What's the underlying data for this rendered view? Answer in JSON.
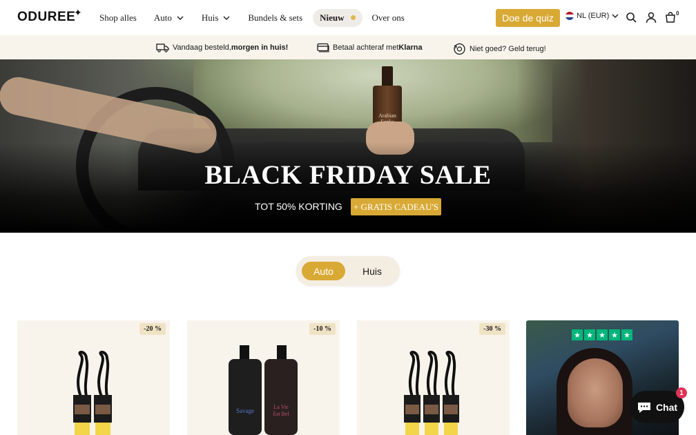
{
  "header": {
    "logo": "ODUREE",
    "nav": [
      {
        "label": "Shop alles",
        "has_dropdown": false
      },
      {
        "label": "Auto",
        "has_dropdown": true
      },
      {
        "label": "Huis",
        "has_dropdown": true
      },
      {
        "label": "Bundels & sets",
        "has_dropdown": false
      }
    ],
    "nav_new": "Nieuw",
    "nav_about": "Over ons",
    "quiz_button": "Doe de quiz",
    "locale": "NL (EUR)",
    "cart_count": "0"
  },
  "usp": [
    {
      "icon": "truck-icon",
      "text_pre": "Vandaag besteld, ",
      "text_bold": "morgen in huis!"
    },
    {
      "icon": "card-icon",
      "text_pre": "Betaal achteraf met ",
      "text_bold": "Klarna"
    },
    {
      "icon": "refund-icon",
      "text_pre": "Niet goed? Geld terug!",
      "text_bold": ""
    }
  ],
  "hero": {
    "product_label": "Arabian Fonka",
    "title": "BLACK FRIDAY SALE",
    "subtitle": "TOT 50% KORTING",
    "badge": "+ GRATIS CADEAU'S"
  },
  "tabs": {
    "active": "Auto",
    "inactive": "Huis"
  },
  "products": [
    {
      "discount": "-20 %"
    },
    {
      "discount": "-10 %"
    },
    {
      "discount": "-30 %"
    }
  ],
  "chat": {
    "label": "Chat",
    "badge": "1"
  },
  "colors": {
    "accent": "#d9a935",
    "usp_bg": "#f8f4ec",
    "trustpilot": "#00b67a"
  }
}
